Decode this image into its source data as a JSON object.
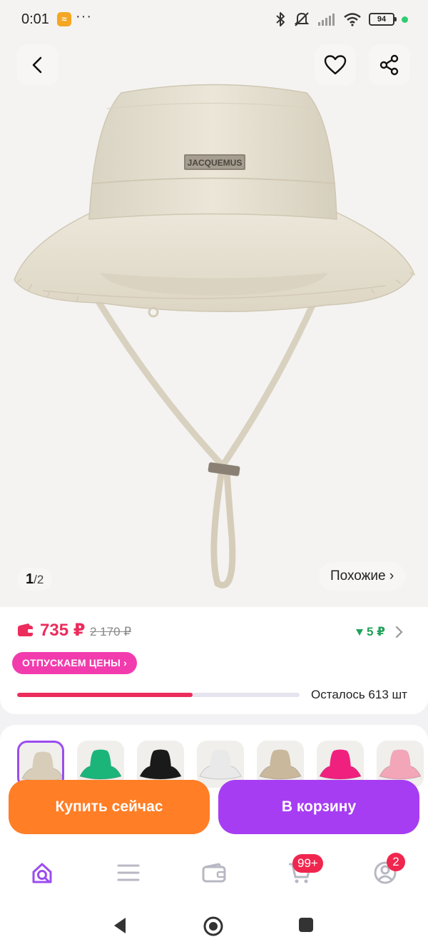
{
  "status_bar": {
    "time": "0:01",
    "app_icon_text": "≈",
    "more": "···",
    "battery": "94",
    "dot_color": "#2ecc71"
  },
  "hero": {
    "brand_plate": "JACQUEMUS",
    "pager_current": "1",
    "pager_sep": "/",
    "pager_total": "2",
    "similar_label": "Похожие ›"
  },
  "price": {
    "current": "735 ₽",
    "old": "2 170 ₽",
    "bonus": "5 ₽",
    "promo_label": "ОТПУСКАЕМ ЦЕНЫ ›",
    "stock_label": "Осталось 613 шт",
    "stock_progress": 0.62,
    "accent_color": "#ec2c5c",
    "bonus_color": "#21a35a",
    "promo_color": "#f23cae"
  },
  "variants": [
    {
      "name": "beige",
      "color": "#d8cdb8",
      "selected": true
    },
    {
      "name": "green",
      "color": "#1bb57a",
      "selected": false
    },
    {
      "name": "black",
      "color": "#1a1a1a",
      "selected": false
    },
    {
      "name": "white",
      "color": "#e9e9e9",
      "selected": false
    },
    {
      "name": "khaki",
      "color": "#c9b89c",
      "selected": false
    },
    {
      "name": "pink",
      "color": "#f0207f",
      "selected": false
    },
    {
      "name": "light-pink",
      "color": "#f2a6b8",
      "selected": false
    }
  ],
  "actions": {
    "buy_now": "Купить сейчас",
    "add_to_cart": "В корзину",
    "buy_color": "#ff7e26",
    "cart_color": "#a73df2"
  },
  "tabbar": {
    "cart_badge": "99+",
    "profile_badge": "2",
    "active_color": "#9b4cf0"
  },
  "icons": [
    "back-icon",
    "heart-icon",
    "share-icon",
    "wallet-icon",
    "chevron-right-icon",
    "search-home-icon",
    "catalog-icon",
    "wallet-tab-icon",
    "cart-icon",
    "profile-icon"
  ]
}
